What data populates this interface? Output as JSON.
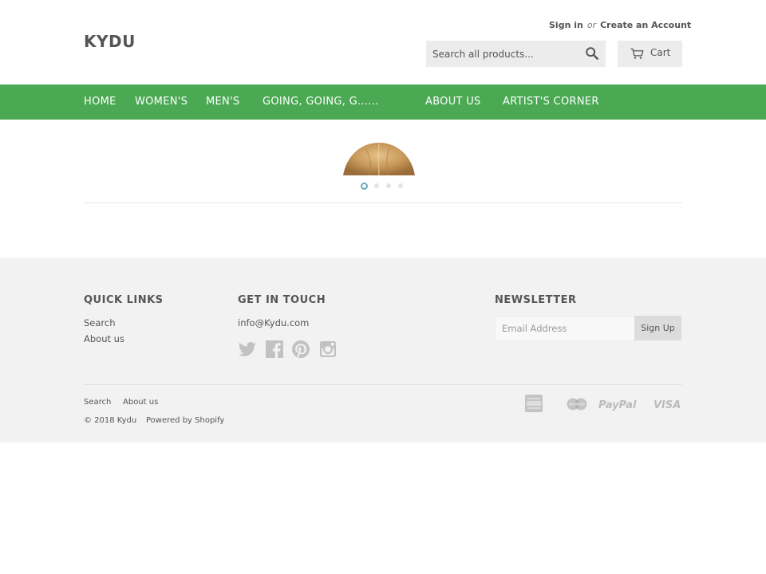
{
  "header": {
    "logo": "KYDU",
    "sign_in": "Sign in",
    "or": "or",
    "create_account": "Create an Account",
    "search_placeholder": "Search all products...",
    "search_icon": "search-icon",
    "cart_label": "Cart",
    "cart_icon": "cart-icon"
  },
  "nav": {
    "items": [
      {
        "label": "HOME"
      },
      {
        "label": "WOMEN'S"
      },
      {
        "label": "MEN'S"
      },
      {
        "label": "GOING, GOING, G......"
      },
      {
        "label": "ABOUT US"
      },
      {
        "label": "ARTIST'S CORNER"
      }
    ],
    "background": "#4ba953"
  },
  "slideshow": {
    "slide_count": 4,
    "active_slide": 1,
    "active_dot_color": "#6aa8b8"
  },
  "footer": {
    "quick_links": {
      "title": "QUICK LINKS",
      "links": [
        "Search",
        "About us"
      ]
    },
    "contact": {
      "title": "GET IN TOUCH",
      "email": "info@Kydu.com",
      "social_icons": [
        "twitter-icon",
        "facebook-icon",
        "pinterest-icon",
        "instagram-icon"
      ]
    },
    "newsletter": {
      "title": "NEWSLETTER",
      "email_placeholder": "Email Address",
      "button_label": "Sign Up"
    },
    "bottom_links": [
      "Search",
      "About us"
    ],
    "copyright": "© 2018 Kydu",
    "powered_by": "Powered by Shopify",
    "payment_icons": [
      "american-express-icon",
      "mastercard-icon",
      "paypal-icon",
      "visa-icon"
    ],
    "paypal_text": "PayPal",
    "visa_text": "VISA",
    "background": "#f2f2f2"
  }
}
